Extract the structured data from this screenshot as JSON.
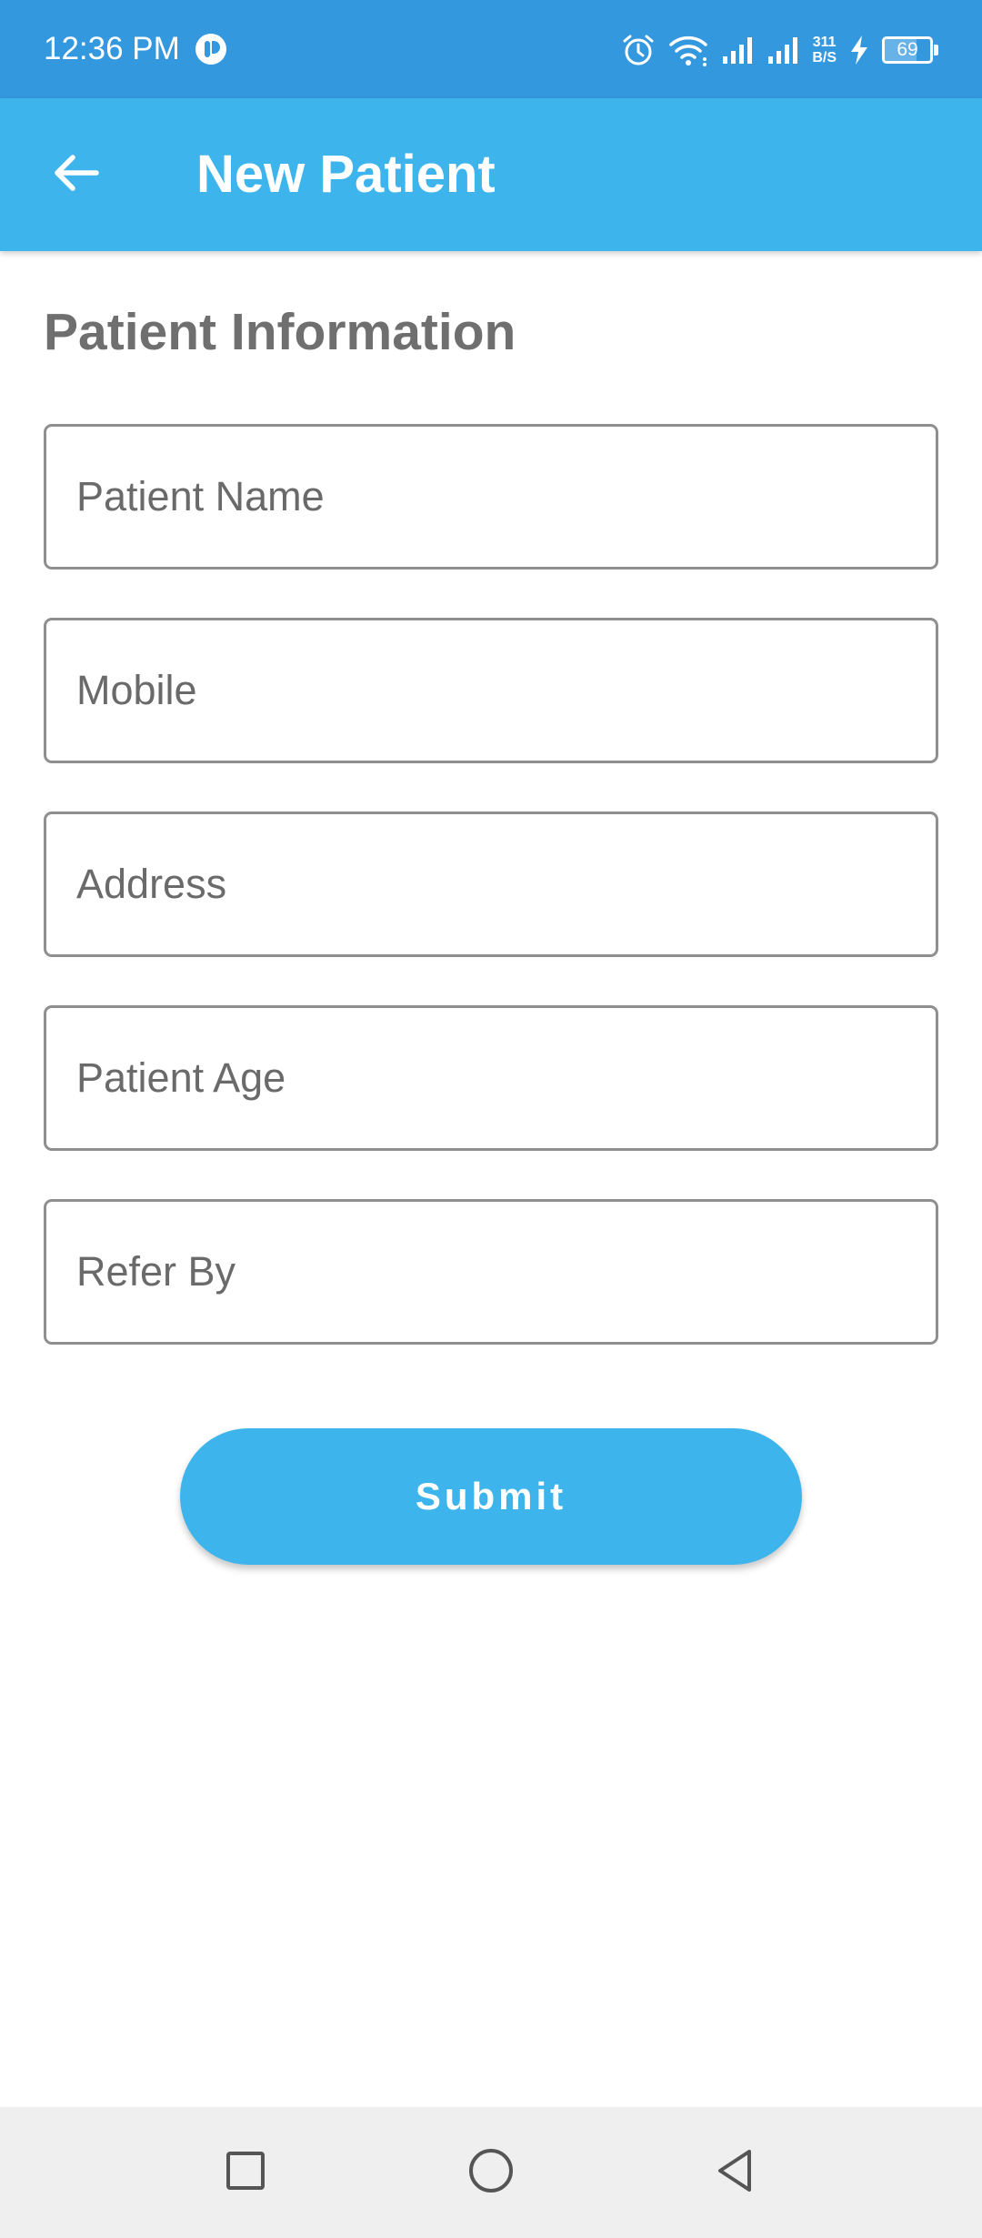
{
  "status_bar": {
    "time": "12:36 PM",
    "net_speed_value": "311",
    "net_speed_unit": "B/S",
    "battery_level": "69",
    "icons": [
      "app-notification-icon",
      "alarm-icon",
      "wifi-icon",
      "signal-icon",
      "signal-icon",
      "charging-icon",
      "battery-icon"
    ]
  },
  "app_bar": {
    "title": "New Patient",
    "back_icon": "arrow-left-icon"
  },
  "form": {
    "section_title": "Patient Information",
    "fields": [
      {
        "placeholder": "Patient Name",
        "value": ""
      },
      {
        "placeholder": "Mobile",
        "value": ""
      },
      {
        "placeholder": "Address",
        "value": ""
      },
      {
        "placeholder": "Patient Age",
        "value": ""
      },
      {
        "placeholder": "Refer By",
        "value": ""
      }
    ],
    "submit_label": "Submit"
  },
  "nav_bar": {
    "icons": [
      "recents-square-icon",
      "home-circle-icon",
      "back-triangle-icon"
    ]
  },
  "colors": {
    "status_bar": "#3498de",
    "app_bar": "#3db5ec",
    "accent": "#3db5ec",
    "section_title": "#6f6f6f",
    "field_border": "#8f8f8f",
    "nav_bar": "#efefef"
  }
}
